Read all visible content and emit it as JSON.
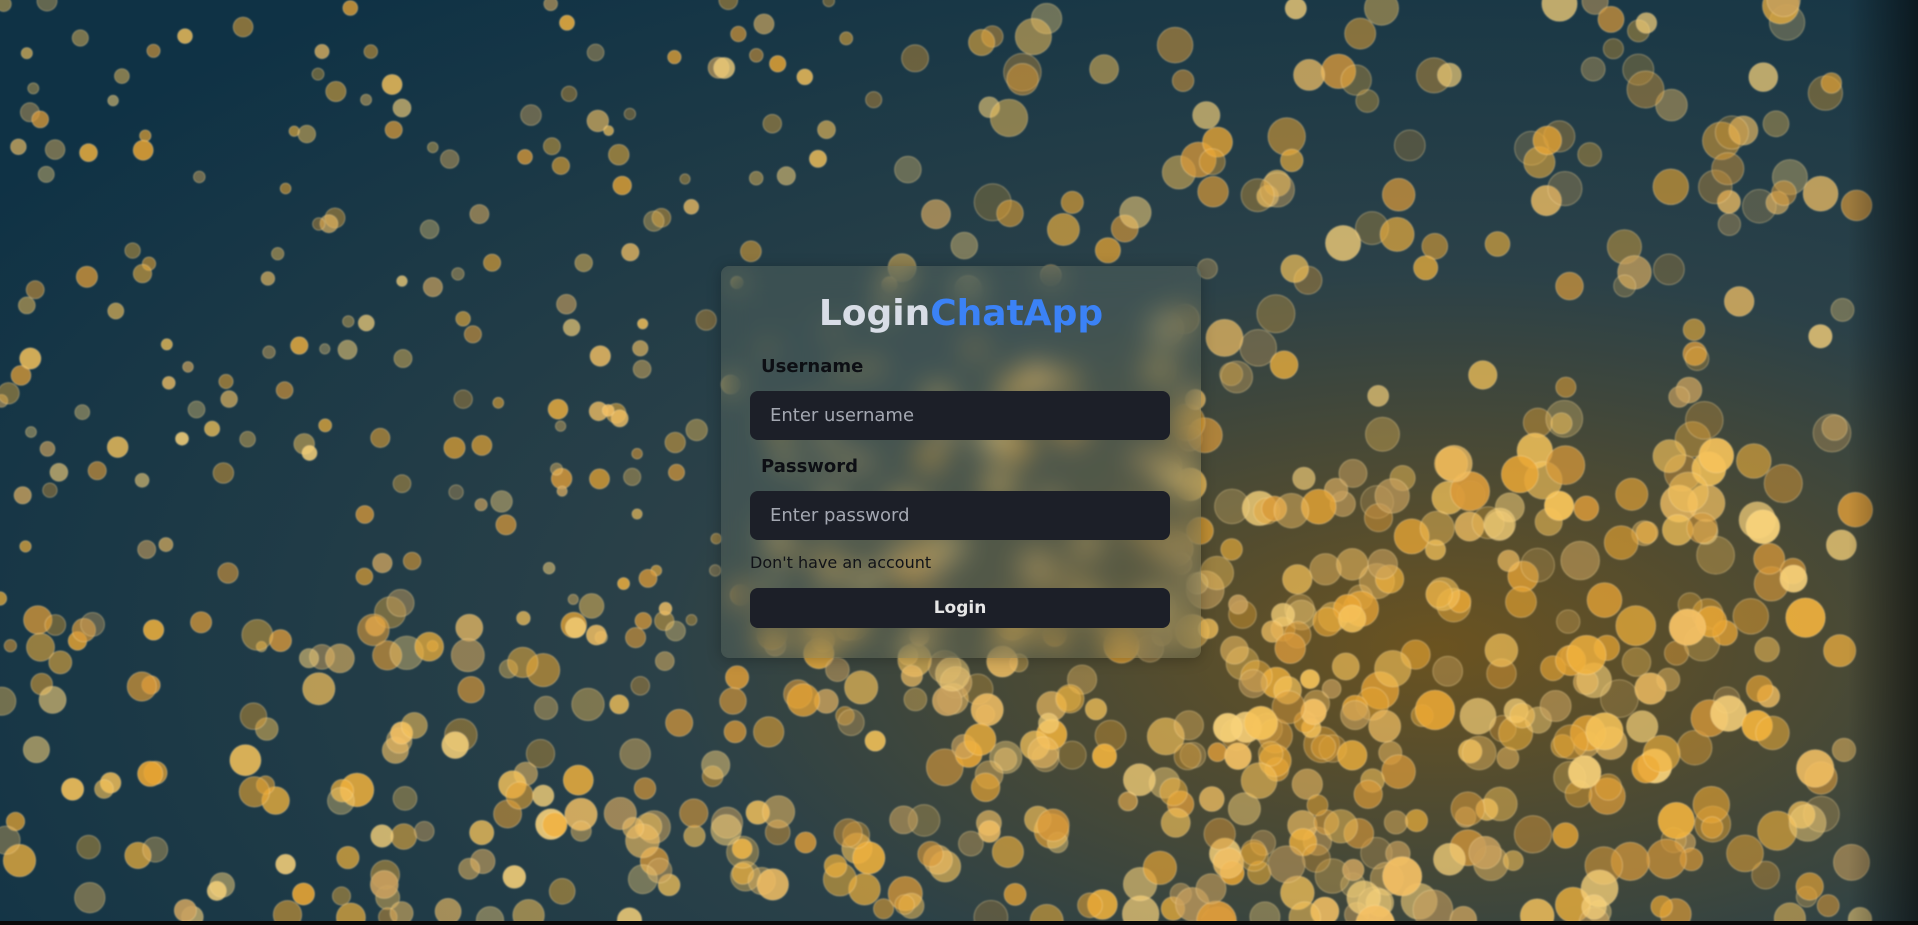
{
  "app": {
    "title_part1": "Login",
    "title_part2": "ChatApp",
    "accent_color": "#3b82f6"
  },
  "form": {
    "username_label": "Username",
    "username_placeholder": "Enter username",
    "username_value": "",
    "password_label": "Password",
    "password_placeholder": "Enter password",
    "password_value": "",
    "signup_link": "Don't have an account",
    "login_button": "Login"
  },
  "background": {
    "description_color_dark": "#143648",
    "description_color_light": "#f5b83a"
  }
}
